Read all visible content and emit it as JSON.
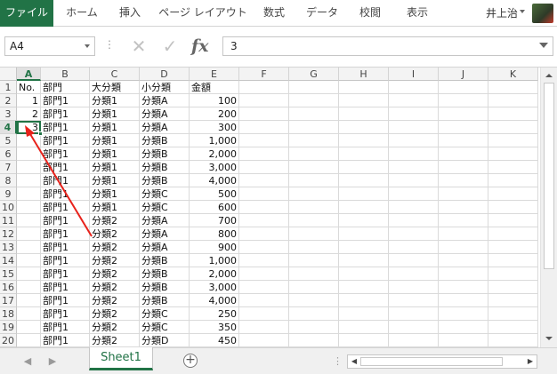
{
  "ribbon": {
    "tabs": [
      "ファイル",
      "ホーム",
      "挿入",
      "ページ レイアウト",
      "数式",
      "データ",
      "校閲",
      "表示"
    ],
    "user_name": "井上治"
  },
  "formula_bar": {
    "name_box": "A4",
    "cancel_icon": "✕",
    "enter_icon": "✓",
    "fx_label": "fx",
    "formula_value": "3"
  },
  "sheet": {
    "columns": [
      "A",
      "B",
      "C",
      "D",
      "E",
      "F",
      "G",
      "H",
      "I",
      "J",
      "K"
    ],
    "active_column": "A",
    "active_row": 4,
    "rows": [
      {
        "num": "1",
        "a": "No.",
        "b": "部門",
        "c": "大分類",
        "d": "小分類",
        "e": "金額"
      },
      {
        "num": "2",
        "a": "1",
        "b": "部門1",
        "c": "分類1",
        "d": "分類A",
        "e": "100"
      },
      {
        "num": "3",
        "a": "2",
        "b": "部門1",
        "c": "分類1",
        "d": "分類A",
        "e": "200"
      },
      {
        "num": "4",
        "a": "3",
        "b": "部門1",
        "c": "分類1",
        "d": "分類A",
        "e": "300"
      },
      {
        "num": "5",
        "a": "",
        "b": "部門1",
        "c": "分類1",
        "d": "分類B",
        "e": "1,000"
      },
      {
        "num": "6",
        "a": "",
        "b": "部門1",
        "c": "分類1",
        "d": "分類B",
        "e": "2,000"
      },
      {
        "num": "7",
        "a": "",
        "b": "部門1",
        "c": "分類1",
        "d": "分類B",
        "e": "3,000"
      },
      {
        "num": "8",
        "a": "",
        "b": "部門1",
        "c": "分類1",
        "d": "分類B",
        "e": "4,000"
      },
      {
        "num": "9",
        "a": "",
        "b": "部門1",
        "c": "分類1",
        "d": "分類C",
        "e": "500"
      },
      {
        "num": "10",
        "a": "",
        "b": "部門1",
        "c": "分類1",
        "d": "分類C",
        "e": "600"
      },
      {
        "num": "11",
        "a": "",
        "b": "部門1",
        "c": "分類2",
        "d": "分類A",
        "e": "700"
      },
      {
        "num": "12",
        "a": "",
        "b": "部門1",
        "c": "分類2",
        "d": "分類A",
        "e": "800"
      },
      {
        "num": "13",
        "a": "",
        "b": "部門1",
        "c": "分類2",
        "d": "分類A",
        "e": "900"
      },
      {
        "num": "14",
        "a": "",
        "b": "部門1",
        "c": "分類2",
        "d": "分類B",
        "e": "1,000"
      },
      {
        "num": "15",
        "a": "",
        "b": "部門1",
        "c": "分類2",
        "d": "分類B",
        "e": "2,000"
      },
      {
        "num": "16",
        "a": "",
        "b": "部門1",
        "c": "分類2",
        "d": "分類B",
        "e": "3,000"
      },
      {
        "num": "17",
        "a": "",
        "b": "部門1",
        "c": "分類2",
        "d": "分類B",
        "e": "4,000"
      },
      {
        "num": "18",
        "a": "",
        "b": "部門1",
        "c": "分類2",
        "d": "分類C",
        "e": "250"
      },
      {
        "num": "19",
        "a": "",
        "b": "部門1",
        "c": "分類2",
        "d": "分類C",
        "e": "350"
      },
      {
        "num": "20",
        "a": "",
        "b": "部門1",
        "c": "分類2",
        "d": "分類D",
        "e": "450"
      }
    ]
  },
  "sheet_tabs": {
    "active": "Sheet1",
    "add_icon": "+"
  },
  "colors": {
    "accent": "#217346",
    "arrow": "#e8221b"
  }
}
